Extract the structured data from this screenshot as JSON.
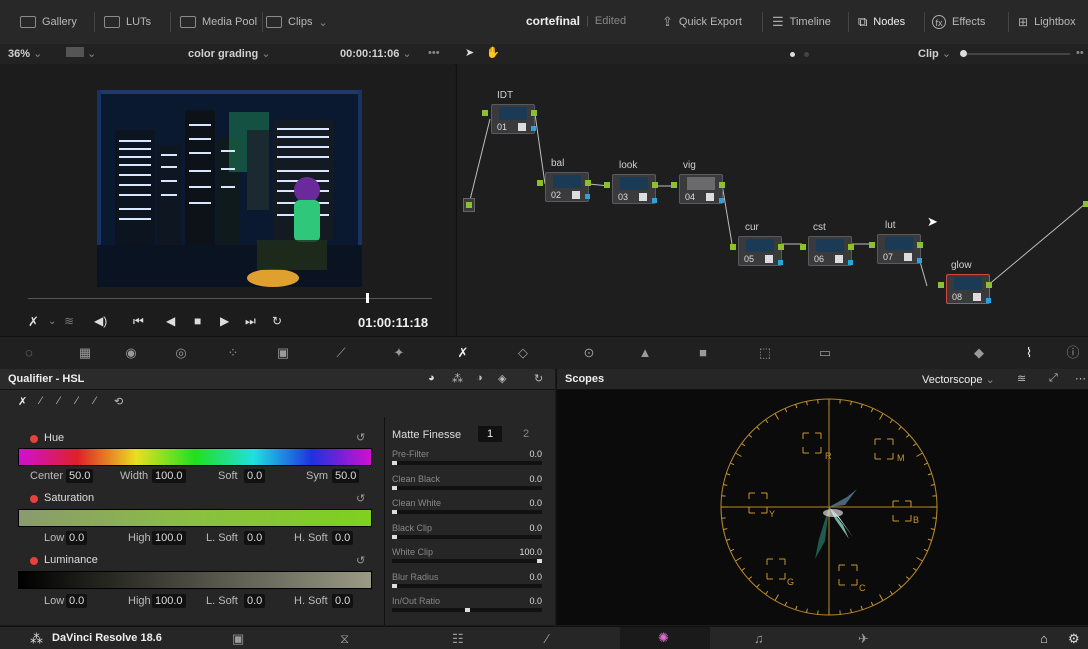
{
  "topbar": {
    "gallery": "Gallery",
    "luts": "LUTs",
    "media_pool": "Media Pool",
    "clips": "Clips",
    "project": "cortefinal",
    "status": "Edited",
    "quick_export": "Quick Export",
    "timeline": "Timeline",
    "nodes": "Nodes",
    "effects": "Effects",
    "lightbox": "Lightbox"
  },
  "viewer_bar": {
    "zoom": "36%",
    "timeline_name": "color grading",
    "source_tc": "00:00:11:06",
    "more": "•••"
  },
  "node_bar": {
    "mode": "Clip",
    "more": "••"
  },
  "transport": {
    "timecode": "01:00:11:18"
  },
  "nodes": [
    {
      "label": "IDT",
      "num": "01"
    },
    {
      "label": "bal",
      "num": "02"
    },
    {
      "label": "look",
      "num": "03"
    },
    {
      "label": "vig",
      "num": "04"
    },
    {
      "label": "cur",
      "num": "05"
    },
    {
      "label": "cst",
      "num": "06"
    },
    {
      "label": "lut",
      "num": "07"
    },
    {
      "label": "glow",
      "num": "08"
    }
  ],
  "qualifier": {
    "title": "Qualifier - HSL",
    "hue": {
      "label": "Hue",
      "center_label": "Center",
      "center": "50.0",
      "width_label": "Width",
      "width": "100.0",
      "soft_label": "Soft",
      "soft": "0.0",
      "sym_label": "Sym",
      "sym": "50.0"
    },
    "saturation": {
      "label": "Saturation",
      "low_label": "Low",
      "low": "0.0",
      "high_label": "High",
      "high": "100.0",
      "lsoft_label": "L. Soft",
      "lsoft": "0.0",
      "hsoft_label": "H. Soft",
      "hsoft": "0.0"
    },
    "luminance": {
      "label": "Luminance",
      "low_label": "Low",
      "low": "0.0",
      "high_label": "High",
      "high": "100.0",
      "lsoft_label": "L. Soft",
      "lsoft": "0.0",
      "hsoft_label": "H. Soft",
      "hsoft": "0.0"
    }
  },
  "matte_finesse": {
    "title": "Matte Finesse",
    "tab1": "1",
    "tab2": "2",
    "rows": [
      {
        "label": "Pre-Filter",
        "value": "0.0",
        "knob": 0.0
      },
      {
        "label": "Clean Black",
        "value": "0.0",
        "knob": 0.0
      },
      {
        "label": "Clean White",
        "value": "0.0",
        "knob": 0.0
      },
      {
        "label": "Black Clip",
        "value": "0.0",
        "knob": 0.0
      },
      {
        "label": "White Clip",
        "value": "100.0",
        "knob": 1.0
      },
      {
        "label": "Blur Radius",
        "value": "0.0",
        "knob": 0.0
      },
      {
        "label": "In/Out Ratio",
        "value": "0.0",
        "knob": 0.5
      }
    ]
  },
  "scopes": {
    "title": "Scopes",
    "mode": "Vectorscope",
    "targets": [
      "R",
      "M",
      "Y",
      "B",
      "G",
      "C"
    ]
  },
  "footer": {
    "app": "DaVinci Resolve 18.6"
  },
  "colors": {
    "node_green": "#8bc12c",
    "node_blue": "#2aa3e0",
    "selected_node": "#d04a3a",
    "qualifier_red": "#e8403c",
    "vectorscope_graticule": "#c9962e"
  }
}
